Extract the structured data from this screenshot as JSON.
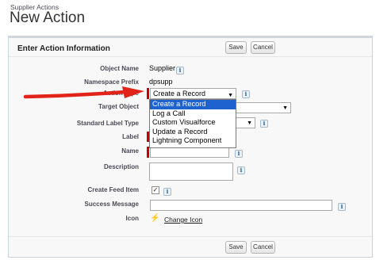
{
  "header": {
    "breadcrumb": "Supplier Actions",
    "title": "New Action"
  },
  "panel": {
    "title": "Enter Action Information"
  },
  "buttons": {
    "save": "Save",
    "cancel": "Cancel"
  },
  "fields": {
    "object_name": {
      "label": "Object Name",
      "value": "Supplier"
    },
    "namespace_prefix": {
      "label": "Namespace Prefix",
      "value": "dpsupp"
    },
    "action_type": {
      "label": "Action Type",
      "value": "Create a Record"
    },
    "target_object": {
      "label": "Target Object",
      "value": ""
    },
    "standard_label_type": {
      "label": "Standard Label Type",
      "value": ""
    },
    "label": {
      "label": "Label",
      "value": ""
    },
    "name": {
      "label": "Name",
      "value": ""
    },
    "description": {
      "label": "Description",
      "value": ""
    },
    "create_feed_item": {
      "label": "Create Feed Item",
      "checked": true
    },
    "success_message": {
      "label": "Success Message",
      "value": ""
    },
    "icon": {
      "label": "Icon",
      "link": "Change Icon"
    }
  },
  "action_type_options": [
    {
      "label": "Create a Record",
      "selected": true
    },
    {
      "label": "Log a Call",
      "selected": false
    },
    {
      "label": "Custom Visualforce",
      "selected": false
    },
    {
      "label": "Update a Record",
      "selected": false
    },
    {
      "label": "Lightning Component",
      "selected": false
    }
  ],
  "icons": {
    "info": "info-icon",
    "arrow": "red-arrow-annotation",
    "bolt": "lightning-bolt-icon",
    "caret": "chevron-down-icon"
  },
  "colors": {
    "required_bar": "#cc0000",
    "annotation_arrow": "#e2231a",
    "selected_option": "#1e62d0"
  },
  "glyphs": {
    "info": "i",
    "caret": "▼",
    "check": "✓",
    "bolt": "⚡"
  }
}
